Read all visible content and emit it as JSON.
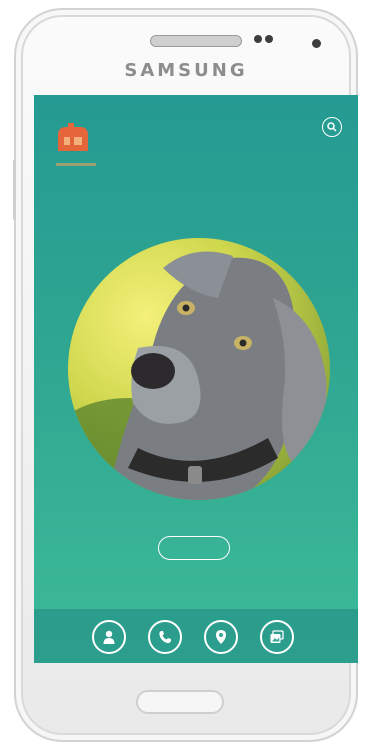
{
  "device": {
    "brand": "SAMSUNG"
  },
  "app": {
    "colors": {
      "screen_top": "#259a92",
      "screen_bottom": "#3dbb98",
      "accent": "#e5663a",
      "foreground": "#ffffff"
    },
    "logo": {
      "icon": "app-logo-icon"
    },
    "header": {
      "search_icon": "search-icon"
    },
    "profile": {
      "photo": "dog-photo"
    },
    "cta": {
      "label": ""
    },
    "nav": {
      "items": [
        {
          "icon": "person-icon"
        },
        {
          "icon": "phone-icon"
        },
        {
          "icon": "location-pin-icon"
        },
        {
          "icon": "gallery-icon"
        }
      ]
    }
  }
}
